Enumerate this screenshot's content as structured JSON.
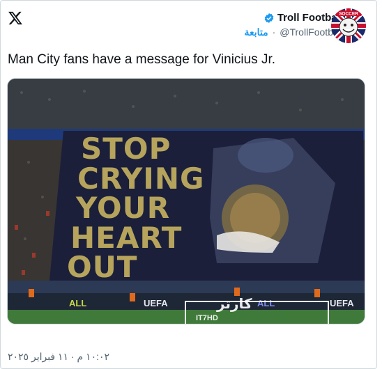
{
  "post": {
    "author_name": "Troll Football",
    "handle": "@TrollFootball",
    "follow_label": "متابعة",
    "text": "Man City fans have a message for Vinicius Jr.",
    "timestamp": "١٠:٠٢ م · ١١ فبراير ٢٠٢٥"
  },
  "media": {
    "banner_lines": [
      "STOP",
      "CRYING",
      "YOUR",
      "HEART",
      "OUT"
    ],
    "ads": [
      "UEFA",
      "ALL",
      "UEFA",
      "ALL",
      "UEFA"
    ],
    "watermark_text": "كارتر",
    "watermark_sub": "IT7HD"
  },
  "avatar": {
    "text": "SOCCER"
  },
  "colors": {
    "accent": "#1d9bf0",
    "text": "#0f1419",
    "muted": "#536471",
    "banner_bg": "#1b1f3a",
    "banner_text": "#b6a45d",
    "pitch": "#3f7a3a"
  },
  "icons": [
    "x-logo-icon",
    "verified-badge-icon"
  ]
}
